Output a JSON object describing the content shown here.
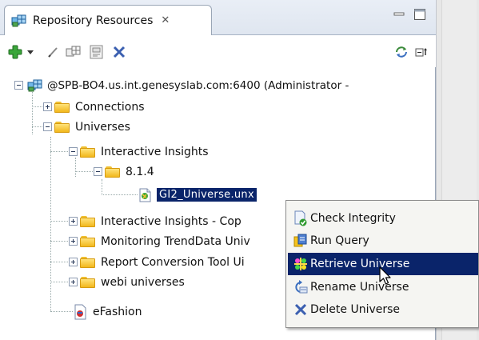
{
  "view": {
    "tab_title": "Repository Resources",
    "tab_close_glyph": "✕"
  },
  "toolbar": {
    "icons": [
      "add-icon",
      "dropdown-arrow-icon",
      "edit-icon",
      "connection-icon",
      "properties-icon",
      "delete-icon",
      "refresh-icon",
      "collapse-all-icon"
    ]
  },
  "tree": {
    "root": "@SPB-BO4.us.int.genesyslab.com:6400 (Administrator -",
    "connections": "Connections",
    "universes": "Universes",
    "interactive_insights": "Interactive Insights",
    "version": "8.1.4",
    "selected_file": "GI2_Universe.unx",
    "interactive_insights_copy": "Interactive Insights - Cop",
    "monitoring": "Monitoring TrendData Univ",
    "report_conversion": "Report Conversion Tool Ui",
    "webi": "webi universes",
    "efashion": "eFashion"
  },
  "context_menu": {
    "check_integrity": "Check Integrity",
    "run_query": "Run Query",
    "retrieve_universe": "Retrieve Universe",
    "rename_universe": "Rename Universe",
    "delete_universe": "Delete Universe",
    "highlighted": "Retrieve Universe"
  },
  "colors": {
    "selection": "#0a246a",
    "folder": "#f2b81c",
    "add_green": "#3aa63a",
    "delete_blue": "#3b5fb0"
  }
}
